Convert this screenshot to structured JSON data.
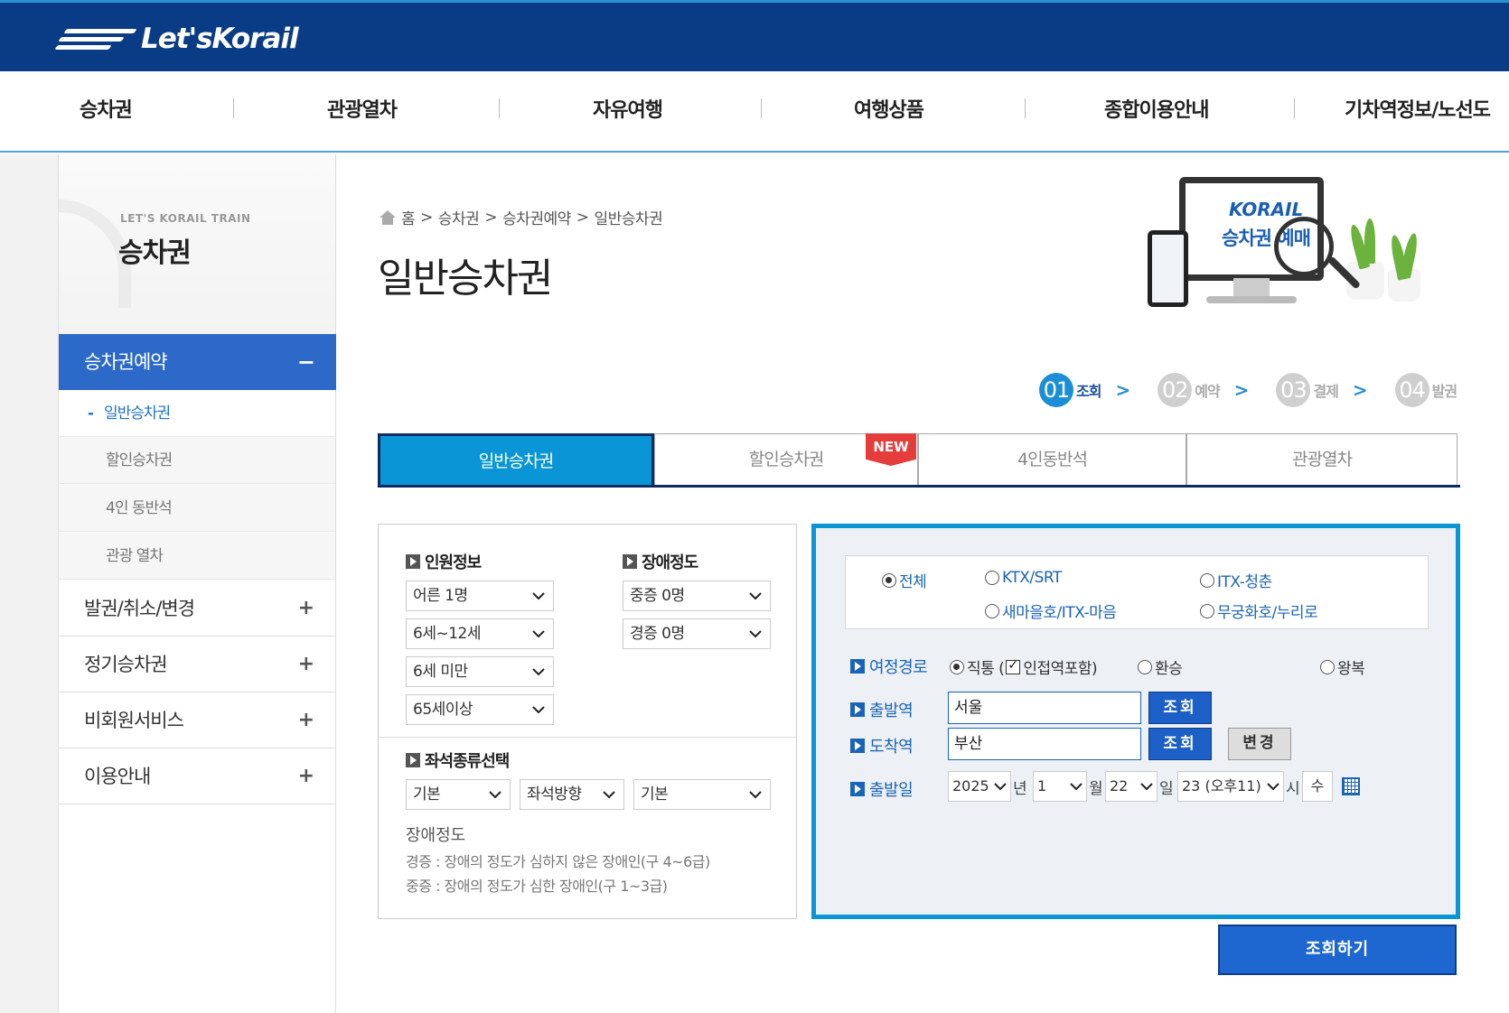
{
  "brand": {
    "logo_text": "Let'sKorail"
  },
  "gnb": [
    "승차권",
    "관광열차",
    "자유여행",
    "여행상품",
    "종합이용안내",
    "기차역정보/노선도"
  ],
  "lnb": {
    "sub": "LET'S KORAIL TRAIN",
    "title": "승차권",
    "active": "승차권예약",
    "active_sign": "−",
    "subitems": [
      "일반승차권",
      "할인승차권",
      "4인 동반석",
      "관광 열차"
    ],
    "items": [
      "발권/취소/변경",
      "정기승차권",
      "비회원서비스",
      "이용안내"
    ],
    "plus": "+"
  },
  "breadcrumb": [
    "홈",
    ">",
    "승차권",
    ">",
    "승차권예약",
    ">",
    "일반승차권"
  ],
  "page_title": "일반승차권",
  "promo": {
    "logo": "KORAIL",
    "text": "승차권 예매"
  },
  "steps": [
    {
      "num": "01",
      "label": "조회",
      "color": "#1a8fd8",
      "text_color": "#1a4fa0"
    },
    {
      "num": "02",
      "label": "예약",
      "color": "#cfcfcf",
      "text_color": "#aaaaaa"
    },
    {
      "num": "03",
      "label": "결제",
      "color": "#cfcfcf",
      "text_color": "#aaaaaa"
    },
    {
      "num": "04",
      "label": "발권",
      "color": "#cfcfcf",
      "text_color": "#aaaaaa"
    }
  ],
  "step_arrow": ">",
  "tabs": [
    "일반승차권",
    "할인승차권",
    "4인동반석",
    "관광열차"
  ],
  "new_badge": "NEW",
  "passenger": {
    "label": "인원정보",
    "selects": [
      "어른 1명",
      "6세~12세",
      "6세 미만",
      "65세이상"
    ]
  },
  "disability": {
    "label": "장애정도",
    "selects": [
      "중증 0명",
      "경증 0명"
    ]
  },
  "seat": {
    "label": "좌석종류선택",
    "selects": [
      "기본",
      "좌석방향",
      "기본"
    ]
  },
  "disability_note": {
    "title": "장애정도",
    "lines": [
      "경증 : 장애의 정도가 심하지 않은 장애인(구 4~6급)",
      "중증 : 장애의 정도가 심한 장애인(구 1~3급)"
    ]
  },
  "train_types": [
    "전체",
    "KTX/SRT",
    "ITX-청춘",
    "새마을호/ITX-마음",
    "무궁화호/누리로"
  ],
  "route": {
    "label": "여정경로",
    "direct": "직통 (",
    "nearby": "인접역포함)",
    "transfer": "환승",
    "roundtrip": "왕복"
  },
  "departure": {
    "label": "출발역",
    "value": "서울",
    "btn": "조회"
  },
  "arrival": {
    "label": "도착역",
    "value": "부산",
    "btn": "조회",
    "swap": "변경"
  },
  "date": {
    "label": "출발일",
    "year": "2025",
    "year_unit": "년",
    "month": "1",
    "month_unit": "월",
    "day": "22",
    "day_unit": "일",
    "hour": "23 (오후11)",
    "hour_unit": "시",
    "weekday": "수"
  },
  "search_button": "조회하기",
  "colors": {
    "header": "#0a3c85",
    "accent": "#0a96d6",
    "button": "#1f67d0"
  }
}
